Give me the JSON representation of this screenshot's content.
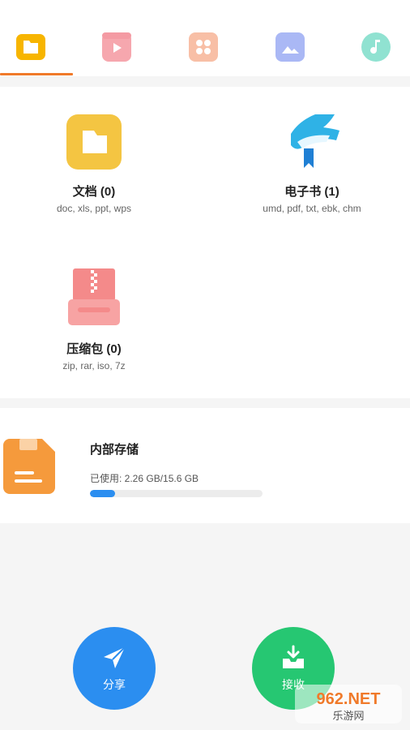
{
  "colors": {
    "accent": "#f07a2a",
    "share": "#2b8ef0",
    "receive": "#26c772",
    "progress": "#2b8ef0"
  },
  "tabs": [
    {
      "icon": "folder-icon",
      "color": "#f7b500",
      "selected": true
    },
    {
      "icon": "video-icon",
      "color": "#f6a0a8",
      "selected": false
    },
    {
      "icon": "apps-icon",
      "color": "#f7b9a0",
      "selected": false
    },
    {
      "icon": "image-icon",
      "color": "#a7b6f5",
      "selected": false
    },
    {
      "icon": "music-icon",
      "color": "#8ee0cf",
      "selected": false
    }
  ],
  "categories": {
    "documents": {
      "title": "文档 (0)",
      "subtitle": "doc, xls, ppt, wps",
      "icon": "folder-icon"
    },
    "ebooks": {
      "title": "电子书 (1)",
      "subtitle": "umd, pdf, txt, ebk, chm",
      "icon": "book-icon"
    },
    "archives": {
      "title": "压缩包 (0)",
      "subtitle": "zip, rar, iso, 7z",
      "icon": "archive-icon"
    }
  },
  "storage": {
    "title": "内部存储",
    "usage": "已使用:   2.26 GB/15.6 GB",
    "used_fraction": 0.145,
    "icon": "sd-card-icon"
  },
  "actions": {
    "share_label": "分享",
    "receive_label": "接收"
  },
  "watermark": {
    "top": "962.NET",
    "bottom": "乐游网"
  }
}
